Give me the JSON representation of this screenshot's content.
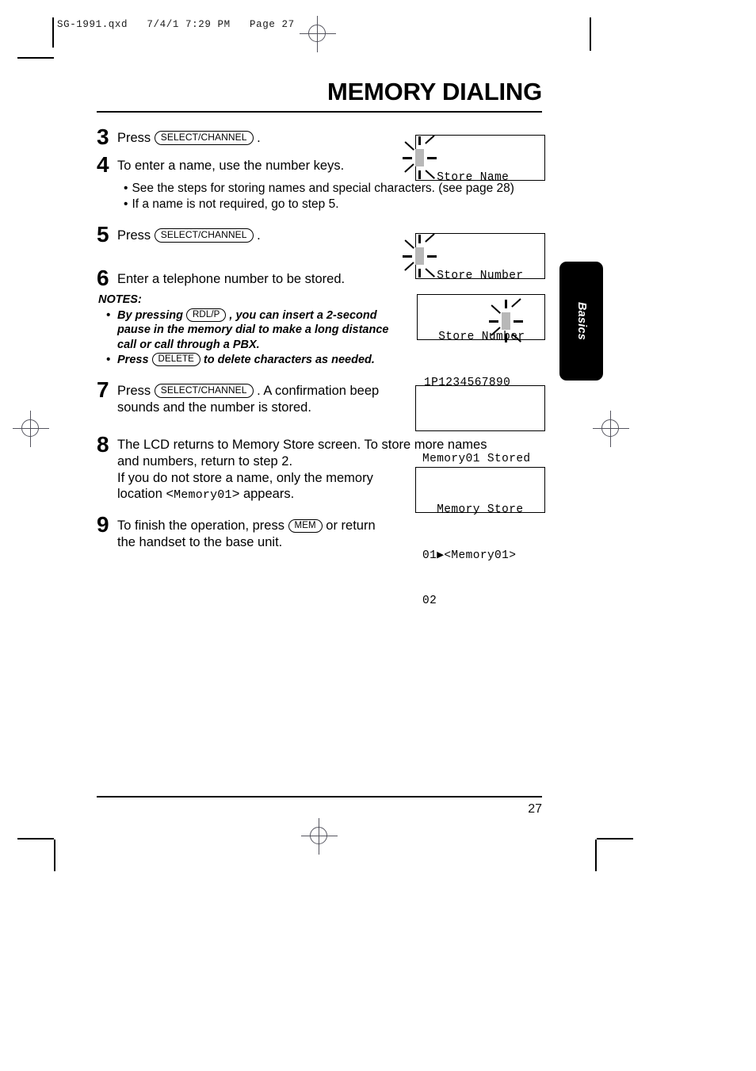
{
  "prepress": {
    "banner": "SG-1991.qxd   7/4/1 7:29 PM   Page 27"
  },
  "header": {
    "title": "MEMORY DIALING"
  },
  "steps": [
    {
      "num": "3",
      "pre": "Press ",
      "key": "SELECT/CHANNEL",
      "post": " ."
    },
    {
      "num": "4",
      "text": "To enter a name, use the number keys."
    },
    {
      "num": "5",
      "pre": "Press ",
      "key": "SELECT/CHANNEL",
      "post": " ."
    },
    {
      "num": "6",
      "text": "Enter a telephone number to be stored."
    },
    {
      "num": "7",
      "pre": "Press ",
      "key": "SELECT/CHANNEL",
      "post": " .  A confirmation beep",
      "line2": "sounds and the number is stored."
    },
    {
      "num": "8",
      "line1": "The LCD returns to Memory Store screen. To store more names",
      "line2": "and numbers, return to step 2.",
      "line3": "If you do not store a name, only the memory",
      "line4_pre": "location <",
      "line4_mono": "Memory01",
      "line4_post": "> appears."
    },
    {
      "num": "9",
      "pre": "To finish the operation, press ",
      "key": "MEM",
      "post": " or return",
      "line2": "the handset to the base unit."
    }
  ],
  "bullets": [
    "See the steps for storing names and special characters. (see page 28)",
    "If a name is not required, go to step 5."
  ],
  "notes": {
    "title": "NOTES:",
    "items": [
      {
        "pre": "By pressing ",
        "key": "RDL/P",
        "post": " , you can insert a 2-second",
        "line2": "pause in the memory dial to make a long distance",
        "line3": "call or call through a PBX."
      },
      {
        "pre": "Press ",
        "key": "DELETE",
        "post": " to delete characters as needed."
      }
    ]
  },
  "lcd_screens": [
    {
      "id": "store-name",
      "lines": [
        "  Store Name",
        "",
        ""
      ],
      "has_blink_cursor": true
    },
    {
      "id": "store-number-prompt",
      "lines": [
        "  Store Number",
        "",
        ""
      ],
      "has_blink_cursor": true
    },
    {
      "id": "store-number-entry",
      "lines": [
        "  Store Number",
        "1P1234567890",
        ""
      ],
      "has_blink_cursor": true
    },
    {
      "id": "memory-stored",
      "lines": [
        "",
        "Memory01 Stored",
        ""
      ],
      "has_blink_cursor": false
    },
    {
      "id": "memory-store-list",
      "lines": [
        "  Memory Store",
        "01▶<Memory01>",
        "02"
      ],
      "has_blink_cursor": false
    }
  ],
  "side_tab": {
    "label": "Basics"
  },
  "footer": {
    "page_number": "27"
  }
}
